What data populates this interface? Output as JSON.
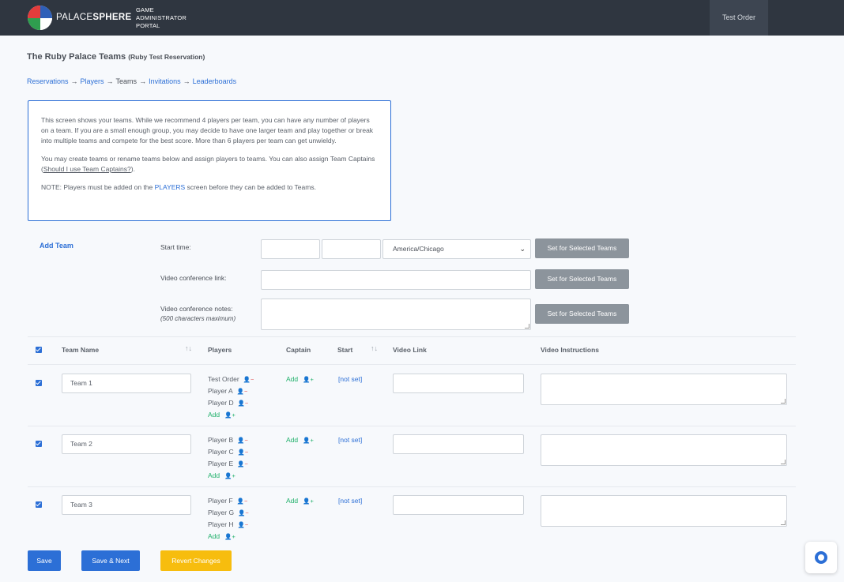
{
  "header": {
    "brand_light": "PALACE",
    "brand_bold": "SPHERE",
    "portal_lines": [
      "GAME",
      "ADMINISTRATOR",
      "PORTAL"
    ],
    "user_tab": "Test Order"
  },
  "page": {
    "title": "The Ruby Palace Teams",
    "subtitle": "(Ruby Test Reservation)"
  },
  "breadcrumb": {
    "items": [
      "Reservations",
      "Players",
      "Teams",
      "Invitations",
      "Leaderboards"
    ],
    "separator": "→"
  },
  "info": {
    "p1": "This screen shows your teams. While we recommend 4 players per team, you can have any number of players on a team. If you are a small enough group, you may decide to have one larger team and play together or break into multiple teams and compete for the best score. More than 6 players per team can get unwieldy.",
    "p2_before": "You may create teams or rename teams below and assign players to teams. You can also assign Team Captains (",
    "p2_link": "Should I use Team Captains?",
    "p2_after": ").",
    "p3_before": "NOTE: Players must be added on the ",
    "p3_link": "PLAYERS",
    "p3_after": " screen before they can be added to Teams."
  },
  "form": {
    "add_team": "Add Team",
    "start_time_label": "Start time:",
    "timezone": "America/Chicago",
    "video_link_label": "Video conference link:",
    "video_notes_label": "Video conference notes:",
    "video_notes_hint": "(500 characters maximum)",
    "set_button": "Set for Selected Teams"
  },
  "table": {
    "headers": {
      "team_name": "Team Name",
      "players": "Players",
      "captain": "Captain",
      "start": "Start",
      "video_link": "Video Link",
      "video_instructions": "Video Instructions"
    },
    "add_label": "Add",
    "not_set": "[not set]",
    "rows": [
      {
        "name": "Team 1",
        "players": [
          "Test Order",
          "Player A",
          "Player D"
        ]
      },
      {
        "name": "Team 2",
        "players": [
          "Player B",
          "Player C",
          "Player E"
        ]
      },
      {
        "name": "Team 3",
        "players": [
          "Player F",
          "Player G",
          "Player H"
        ]
      }
    ]
  },
  "footer": {
    "save": "Save",
    "save_next": "Save & Next",
    "revert": "Revert Changes"
  },
  "colors": {
    "topbar": "#2f3640",
    "accent_blue": "#2c6fd6",
    "add_green": "#1fb06a",
    "remove_red": "#e04b4b",
    "revert_yellow": "#f7bd0e"
  },
  "icons": {
    "remove_player": "user-minus-icon",
    "add_player": "user-plus-icon",
    "help": "lifebuoy-icon"
  }
}
